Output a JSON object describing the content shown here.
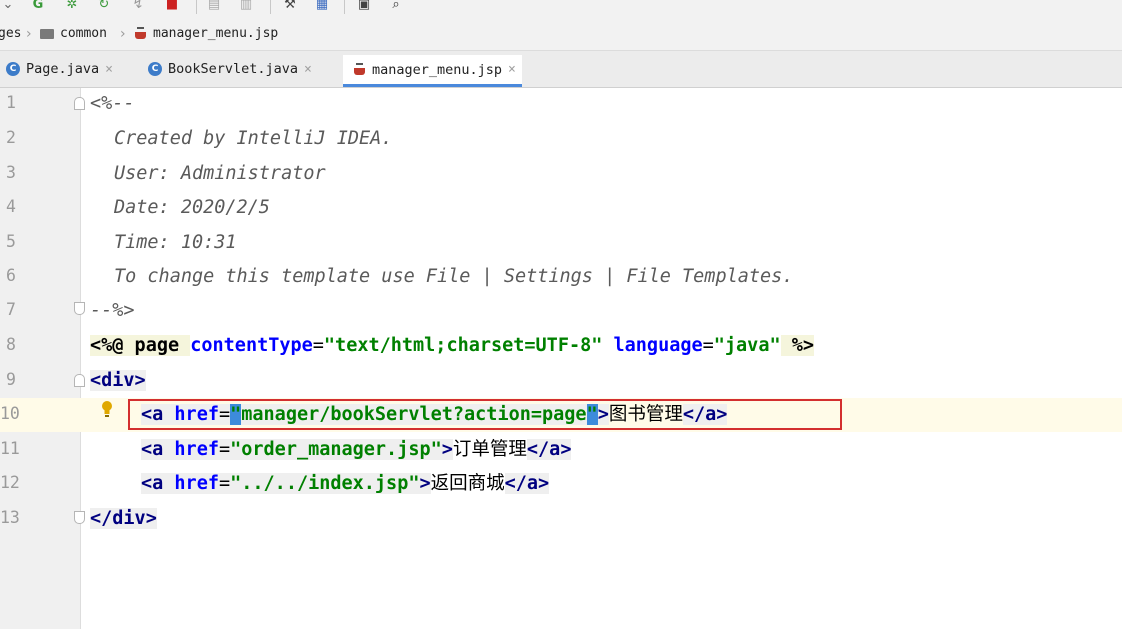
{
  "breadcrumb": {
    "items": [
      "ges",
      "common",
      "manager_menu.jsp"
    ],
    "icons": [
      "folder-icon",
      "jsp-file-icon"
    ]
  },
  "tabs": [
    {
      "label": "Page.java",
      "icon": "java-class-icon",
      "active": false
    },
    {
      "label": "BookServlet.java",
      "icon": "java-class-icon",
      "active": false
    },
    {
      "label": "manager_menu.jsp",
      "icon": "jsp-file-icon",
      "active": true
    }
  ],
  "editor": {
    "line_numbers": [
      "1",
      "2",
      "3",
      "4",
      "5",
      "6",
      "7",
      "8",
      "9",
      "10",
      "11",
      "12",
      "13"
    ],
    "lines": {
      "l1": "<%--",
      "l2": "Created by IntelliJ IDEA.",
      "l3": "User: Administrator",
      "l4": "Date: 2020/2/5",
      "l5": "Time: 10:31",
      "l6": "To change this template use File | Settings | File Templates.",
      "l7": "--%>",
      "l8": {
        "open": "<%@ page ",
        "attr1": "contentType",
        "eq1": "=",
        "val1": "\"text/html;charset=UTF-8\"",
        "attr2": " language",
        "eq2": "=",
        "val2": "\"java\"",
        "close": " %>"
      },
      "l9": "<div>",
      "l10": {
        "tag_open": "<a ",
        "attr": "href",
        "eq": "=",
        "quote_open": "\"",
        "val": "manager/bookServlet?action=page",
        "quote_close": "\"",
        "gt": ">",
        "text": "图书管理",
        "tag_close": "</a>"
      },
      "l11": {
        "tag_open": "<a ",
        "attr": "href",
        "eq": "=",
        "val": "\"order_manager.jsp\"",
        "gt": ">",
        "text": "订单管理",
        "tag_close": "</a>"
      },
      "l12": {
        "tag_open": "<a ",
        "attr": "href",
        "eq": "=",
        "val": "\"../../index.jsp\"",
        "gt": ">",
        "text": "返回商城",
        "tag_close": "</a>"
      },
      "l13": "</div>"
    }
  },
  "colors": {
    "highlight_box": "#d32f2f",
    "current_line": "#fffbe8",
    "tag": "#000080",
    "attribute": "#0000ff",
    "string": "#008000",
    "tab_active_underline": "#4a89dc"
  }
}
